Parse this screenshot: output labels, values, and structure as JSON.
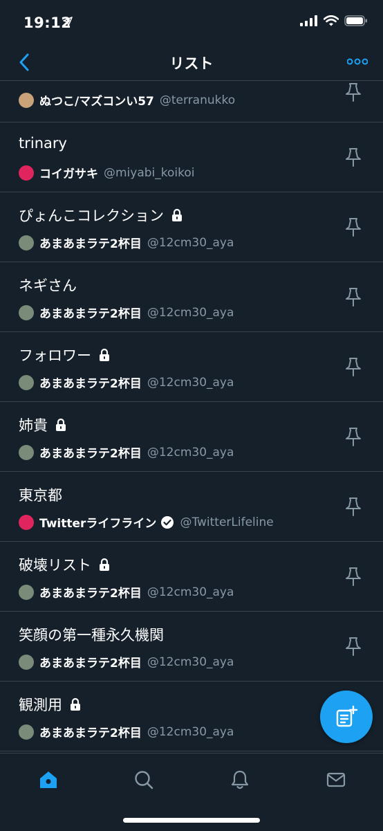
{
  "status_bar": {
    "time": "19:12"
  },
  "nav": {
    "title": "リスト"
  },
  "lists": [
    {
      "name": "",
      "owner_name": "ぬつこ/マズコンい57",
      "owner_handle": "@terranukko",
      "locked": false,
      "avatar_color": "#c9a27a"
    },
    {
      "name": "trinary",
      "owner_name": "コイガサキ",
      "owner_handle": "@miyabi_koikoi",
      "locked": false,
      "avatar_color": "#e0245e"
    },
    {
      "name": "ぴょんこコレクション",
      "owner_name": "あまあまラテ2杯目",
      "owner_handle": "@12cm30_aya",
      "locked": true,
      "avatar_color": "#7a8b7a"
    },
    {
      "name": "ネギさん",
      "owner_name": "あまあまラテ2杯目",
      "owner_handle": "@12cm30_aya",
      "locked": false,
      "avatar_color": "#7a8b7a"
    },
    {
      "name": "フォロワー",
      "owner_name": "あまあまラテ2杯目",
      "owner_handle": "@12cm30_aya",
      "locked": true,
      "avatar_color": "#7a8b7a"
    },
    {
      "name": "姉貴",
      "owner_name": "あまあまラテ2杯目",
      "owner_handle": "@12cm30_aya",
      "locked": true,
      "avatar_color": "#7a8b7a"
    },
    {
      "name": "東京都",
      "owner_name": "Twitterライフライン",
      "owner_handle": "@TwitterLifeline",
      "locked": false,
      "verified": true,
      "avatar_color": "#e0245e"
    },
    {
      "name": "破壊リスト",
      "owner_name": "あまあまラテ2杯目",
      "owner_handle": "@12cm30_aya",
      "locked": true,
      "avatar_color": "#7a8b7a"
    },
    {
      "name": "笑顔の第一種永久機関",
      "owner_name": "あまあまラテ2杯目",
      "owner_handle": "@12cm30_aya",
      "locked": false,
      "avatar_color": "#7a8b7a"
    },
    {
      "name": "観測用",
      "owner_name": "あまあまラテ2杯目",
      "owner_handle": "@12cm30_aya",
      "locked": true,
      "avatar_color": "#7a8b7a"
    }
  ],
  "colors": {
    "background": "#15202b",
    "accent": "#1da1f2",
    "divider": "#38444d",
    "secondary_text": "#8899a6"
  },
  "tabs": [
    {
      "icon": "home-icon",
      "active": true
    },
    {
      "icon": "search-icon",
      "active": false
    },
    {
      "icon": "bell-icon",
      "active": false
    },
    {
      "icon": "mail-icon",
      "active": false
    }
  ]
}
